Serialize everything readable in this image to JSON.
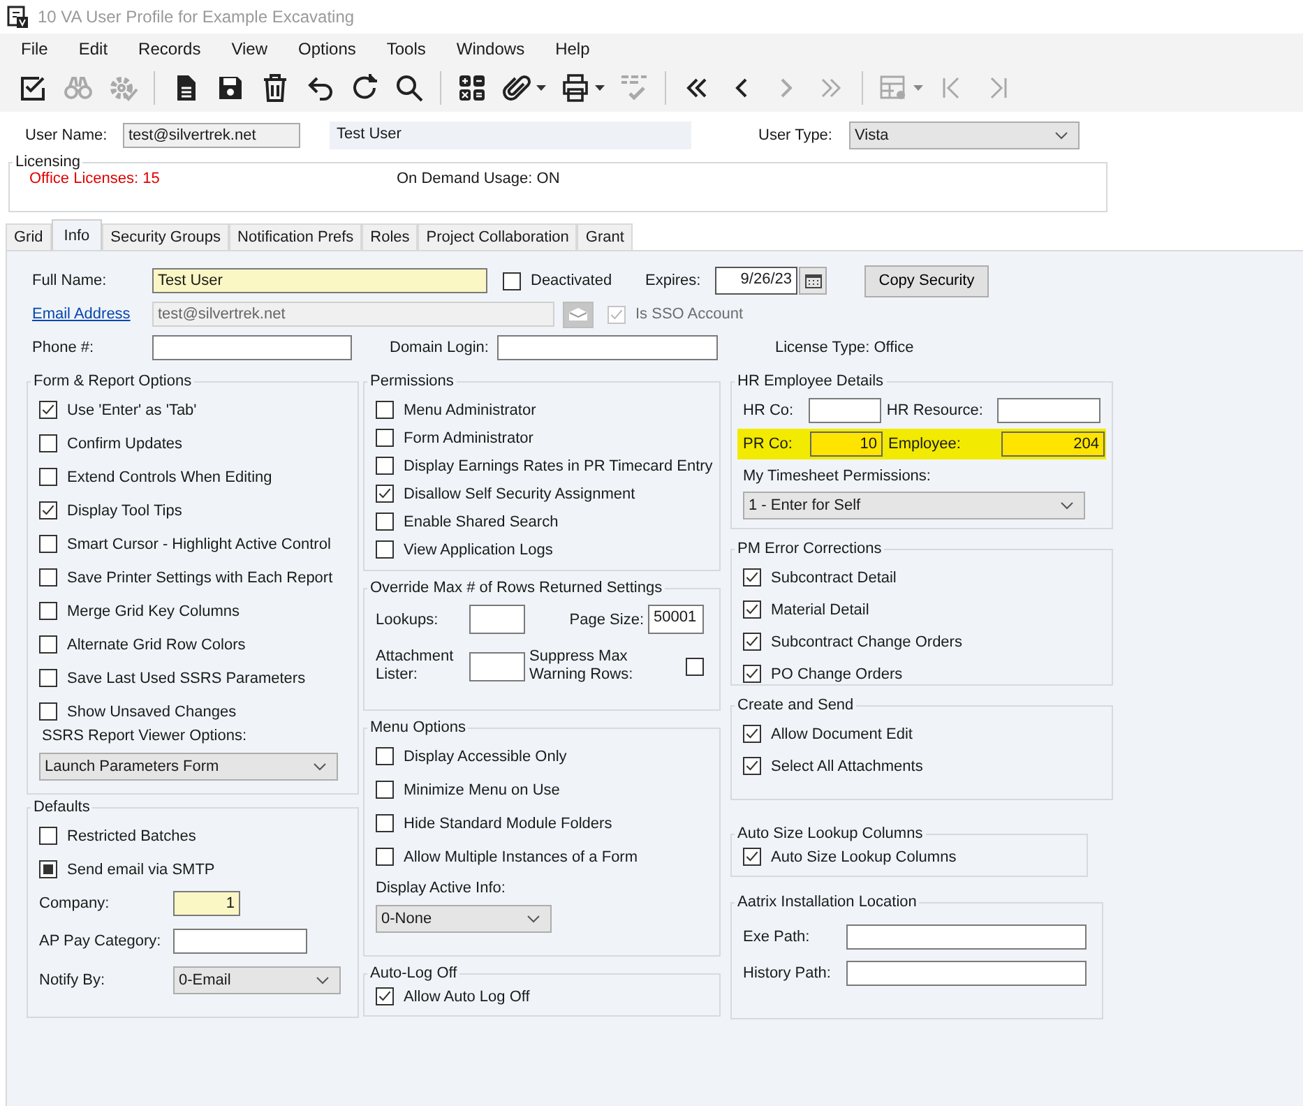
{
  "window": {
    "title": "10 VA User Profile for Example Excavating"
  },
  "menu": [
    "File",
    "Edit",
    "Records",
    "View",
    "Options",
    "Tools",
    "Windows",
    "Help"
  ],
  "toolbar": [
    [
      {
        "kind": "edit",
        "disabled": false,
        "dropdown": false
      },
      {
        "kind": "binoculars",
        "disabled": true,
        "dropdown": false
      },
      {
        "kind": "gear",
        "disabled": true,
        "dropdown": false
      }
    ],
    [
      {
        "kind": "document",
        "disabled": false,
        "dropdown": false
      },
      {
        "kind": "save",
        "disabled": false,
        "dropdown": false
      },
      {
        "kind": "trash",
        "disabled": false,
        "dropdown": false
      },
      {
        "kind": "undo",
        "disabled": false,
        "dropdown": false
      },
      {
        "kind": "redo",
        "disabled": false,
        "dropdown": false
      },
      {
        "kind": "search",
        "disabled": false,
        "dropdown": false
      }
    ],
    [
      {
        "kind": "calculator",
        "disabled": false,
        "dropdown": false
      },
      {
        "kind": "paperclip",
        "disabled": false,
        "dropdown": true
      },
      {
        "kind": "printer",
        "disabled": false,
        "dropdown": true
      },
      {
        "kind": "spelling",
        "disabled": true,
        "dropdown": false
      }
    ],
    [
      {
        "kind": "first",
        "disabled": false,
        "dropdown": false
      },
      {
        "kind": "previous",
        "disabled": false,
        "dropdown": false
      },
      {
        "kind": "next",
        "disabled": true,
        "dropdown": false
      },
      {
        "kind": "last",
        "disabled": true,
        "dropdown": false
      }
    ],
    [
      {
        "kind": "grid-settings",
        "disabled": true,
        "dropdown": true
      },
      {
        "kind": "start",
        "disabled": true,
        "dropdown": false
      },
      {
        "kind": "end",
        "disabled": true,
        "dropdown": false
      }
    ]
  ],
  "header": {
    "user_name": {
      "label": "User Name:",
      "value": "test@silvertrek.net"
    },
    "display_name": "Test User",
    "user_type": {
      "label": "User Type:",
      "value": "Vista"
    }
  },
  "licensing": {
    "title": "Licensing",
    "office_licenses": "Office Licenses: 15",
    "on_demand_usage": "On Demand Usage: ON"
  },
  "tabs": [
    {
      "label": "Grid",
      "selected": false
    },
    {
      "label": "Info",
      "selected": true
    },
    {
      "label": "Security Groups",
      "selected": false
    },
    {
      "label": "Notification Prefs",
      "selected": false
    },
    {
      "label": "Roles",
      "selected": false
    },
    {
      "label": "Project Collaboration",
      "selected": false
    },
    {
      "label": "Grant",
      "selected": false
    }
  ],
  "info": {
    "full_name": {
      "label": "Full Name:",
      "value": "Test User",
      "required": true
    },
    "deactivated": {
      "label": "Deactivated",
      "checked": false
    },
    "expires": {
      "label": "Expires:",
      "value": "9/26/23"
    },
    "copy_security": "Copy Security",
    "email": {
      "link": "Email Address",
      "value": "test@silvertrek.net"
    },
    "sso": {
      "label": "Is SSO Account",
      "checked": true,
      "disabled": true
    },
    "phone": {
      "label": "Phone #:"
    },
    "domain_login": {
      "label": "Domain Login:"
    },
    "license_type": "License Type: Office",
    "form_report_options": {
      "title": "Form & Report Options",
      "options": [
        {
          "label": "Use 'Enter' as 'Tab'",
          "checked": true
        },
        {
          "label": "Confirm Updates",
          "checked": false
        },
        {
          "label": "Extend Controls When Editing",
          "checked": false
        },
        {
          "label": "Display Tool Tips",
          "checked": true
        },
        {
          "label": "Smart Cursor - Highlight Active Control",
          "checked": false
        },
        {
          "label": "Save Printer Settings with Each Report",
          "checked": false
        },
        {
          "label": "Merge Grid Key Columns",
          "checked": false
        },
        {
          "label": "Alternate Grid Row Colors",
          "checked": false
        },
        {
          "label": "Save Last Used SSRS Parameters",
          "checked": false
        },
        {
          "label": "Show Unsaved Changes",
          "checked": false
        }
      ],
      "ssrs_viewer": {
        "label": "SSRS Report Viewer Options:",
        "value": "Launch Parameters Form"
      }
    },
    "defaults": {
      "title": "Defaults",
      "options": [
        {
          "label": "Restricted Batches",
          "checked": false,
          "indeterminate": false
        },
        {
          "label": "Send email via SMTP",
          "checked": false,
          "indeterminate": true
        }
      ],
      "company": {
        "label": "Company:",
        "value": "1",
        "required": true
      },
      "ap_pay_category": {
        "label": "AP Pay Category:"
      },
      "notify_by": {
        "label": "Notify By:",
        "value": "0-Email"
      }
    },
    "permissions": {
      "title": "Permissions",
      "options": [
        {
          "label": "Menu Administrator",
          "checked": false
        },
        {
          "label": "Form Administrator",
          "checked": false
        },
        {
          "label": "Display Earnings Rates in PR Timecard Entry",
          "checked": false
        },
        {
          "label": "Disallow Self Security Assignment",
          "checked": true
        },
        {
          "label": "Enable Shared Search",
          "checked": false
        },
        {
          "label": "View Application Logs",
          "checked": false
        }
      ]
    },
    "override_max_rows": {
      "title": "Override Max # of Rows Returned Settings",
      "lookups": {
        "label": "Lookups:"
      },
      "page_size": {
        "label": "Page Size:",
        "value": "50001"
      },
      "attachment_lister": {
        "label": "Attachment Lister:"
      },
      "suppress_max_warning_rows": {
        "label": "Suppress Max Warning Rows:",
        "checked": false
      }
    },
    "menu_options": {
      "title": "Menu Options",
      "options": [
        {
          "label": "Display Accessible Only",
          "checked": false
        },
        {
          "label": "Minimize Menu on Use",
          "checked": false
        },
        {
          "label": "Hide Standard Module Folders",
          "checked": false
        },
        {
          "label": "Allow Multiple Instances of a Form",
          "checked": false
        }
      ],
      "display_active_info": {
        "label": "Display Active Info:",
        "value": "0-None"
      }
    },
    "auto_log_off": {
      "title": "Auto-Log Off",
      "options": [
        {
          "label": "Allow Auto Log Off",
          "checked": true
        }
      ]
    },
    "hr_employee_details": {
      "title": "HR Employee Details",
      "hr_co": {
        "label": "HR Co:"
      },
      "hr_resource": {
        "label": "HR Resource:"
      },
      "pr_row": {
        "highlighted": true,
        "pr_co": {
          "label": "PR Co:",
          "value": "10"
        },
        "employee": {
          "label": "Employee:",
          "value": "204"
        }
      },
      "timesheet_permissions": {
        "label": "My Timesheet Permissions:",
        "value": "1 - Enter for Self"
      }
    },
    "pm_error_corrections": {
      "title": "PM Error Corrections",
      "options": [
        {
          "label": "Subcontract Detail",
          "checked": true
        },
        {
          "label": "Material Detail",
          "checked": true
        },
        {
          "label": "Subcontract Change Orders",
          "checked": true
        },
        {
          "label": "PO Change Orders",
          "checked": true
        }
      ]
    },
    "create_and_send": {
      "title": "Create and Send",
      "options": [
        {
          "label": "Allow Document Edit",
          "checked": true
        },
        {
          "label": "Select All Attachments",
          "checked": true
        }
      ]
    },
    "auto_size_lookup_columns": {
      "title": "Auto Size Lookup Columns",
      "options": [
        {
          "label": "Auto Size Lookup Columns",
          "checked": true
        }
      ]
    },
    "aatrix_installation_location": {
      "title": "Aatrix Installation Location",
      "exe_path": {
        "label": "Exe Path:"
      },
      "history_path": {
        "label": "History Path:"
      }
    }
  }
}
